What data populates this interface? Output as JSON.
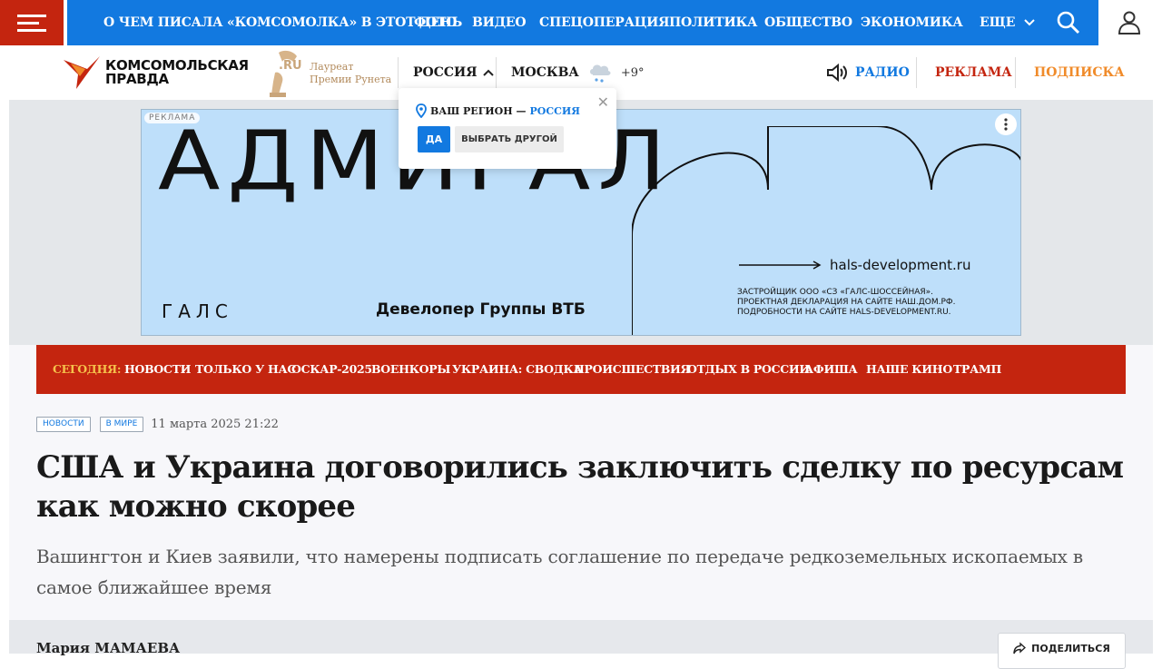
{
  "nav": {
    "links": [
      "О ЧЕМ ПИСАЛА «КОМСОМОЛКА» В ЭТОТ ДЕНЬ",
      "ФОТО",
      "ВИДЕО",
      "СПЕЦОПЕРАЦИЯ",
      "ПОЛИТИКА",
      "ОБЩЕСТВО",
      "ЭКОНОМИКА"
    ],
    "more_label": "ЕЩЕ",
    "menu_icon": "hamburger-icon",
    "search_icon": "search-icon",
    "user_icon": "user-icon"
  },
  "header": {
    "logo_line1": "КОМСОМОЛЬСКАЯ",
    "logo_line2": "ПРАВДА",
    "award_line1": "Лауреат",
    "award_line2": "Премии Рунета",
    "region": "РОССИЯ",
    "city": "МОСКВА",
    "temperature": "+9°",
    "weather_icon": "snow-cloud-icon",
    "radio_label": "РАДИО",
    "ads_label": "РЕКЛАМА",
    "subscribe_label": "ПОДПИСКА"
  },
  "region_popup": {
    "question": "ВАШ РЕГИОН —",
    "region": "РОССИЯ",
    "yes_label": "ДА",
    "other_label": "ВЫБРАТЬ ДРУГОЙ"
  },
  "ad": {
    "badge": "РЕКЛАМА",
    "title": "АДМИРАЛ",
    "brand": "ГАЛС",
    "tagline": "Девелопер Группы ВТБ",
    "url": "hals-development.ru",
    "legal_1": "ЗАСТРОЙЩИК ООО «СЗ «ГАЛС-ШОССЕЙНАЯ».",
    "legal_2": "ПРОЕКТНАЯ ДЕКЛАРАЦИЯ НА САЙТЕ НАШ.ДОМ.РФ.",
    "legal_3": "ПОДРОБНОСТИ НА САЙТЕ HALS-DEVELOPMENT.RU."
  },
  "today": {
    "label": "СЕГОДНЯ:",
    "items": [
      "НОВОСТИ",
      "ТОЛЬКО У НАС",
      "ОСКАР-2025",
      "ВОЕНКОРЫ",
      "УКРАИНА: СВОДКА",
      "ПРОИСШЕСТВИЯ",
      "ОТДЫХ В РОССИИ",
      "АФИША",
      "НАШЕ КИНО",
      "ТРАМП"
    ]
  },
  "article": {
    "tags": [
      "НОВОСТИ",
      "В МИРЕ"
    ],
    "date": "11 марта 2025 21:22",
    "headline": "США и Украина договорились заключить сделку по ресурсам как можно скорее",
    "lead": "Вашингтон и Киев заявили, что намерены подписать соглашение по передаче редкоземельных ископаемых в самое ближайшее время",
    "author": "Мария МАМАЕВА",
    "share_label": "ПОДЕЛИТЬСЯ"
  },
  "colors": {
    "brand_red": "#c4250f",
    "nav_blue": "#1279e0",
    "subscribe_orange": "#f08b2a",
    "today_label_yellow": "#f5c24b",
    "ad_background": "#bedffa"
  }
}
